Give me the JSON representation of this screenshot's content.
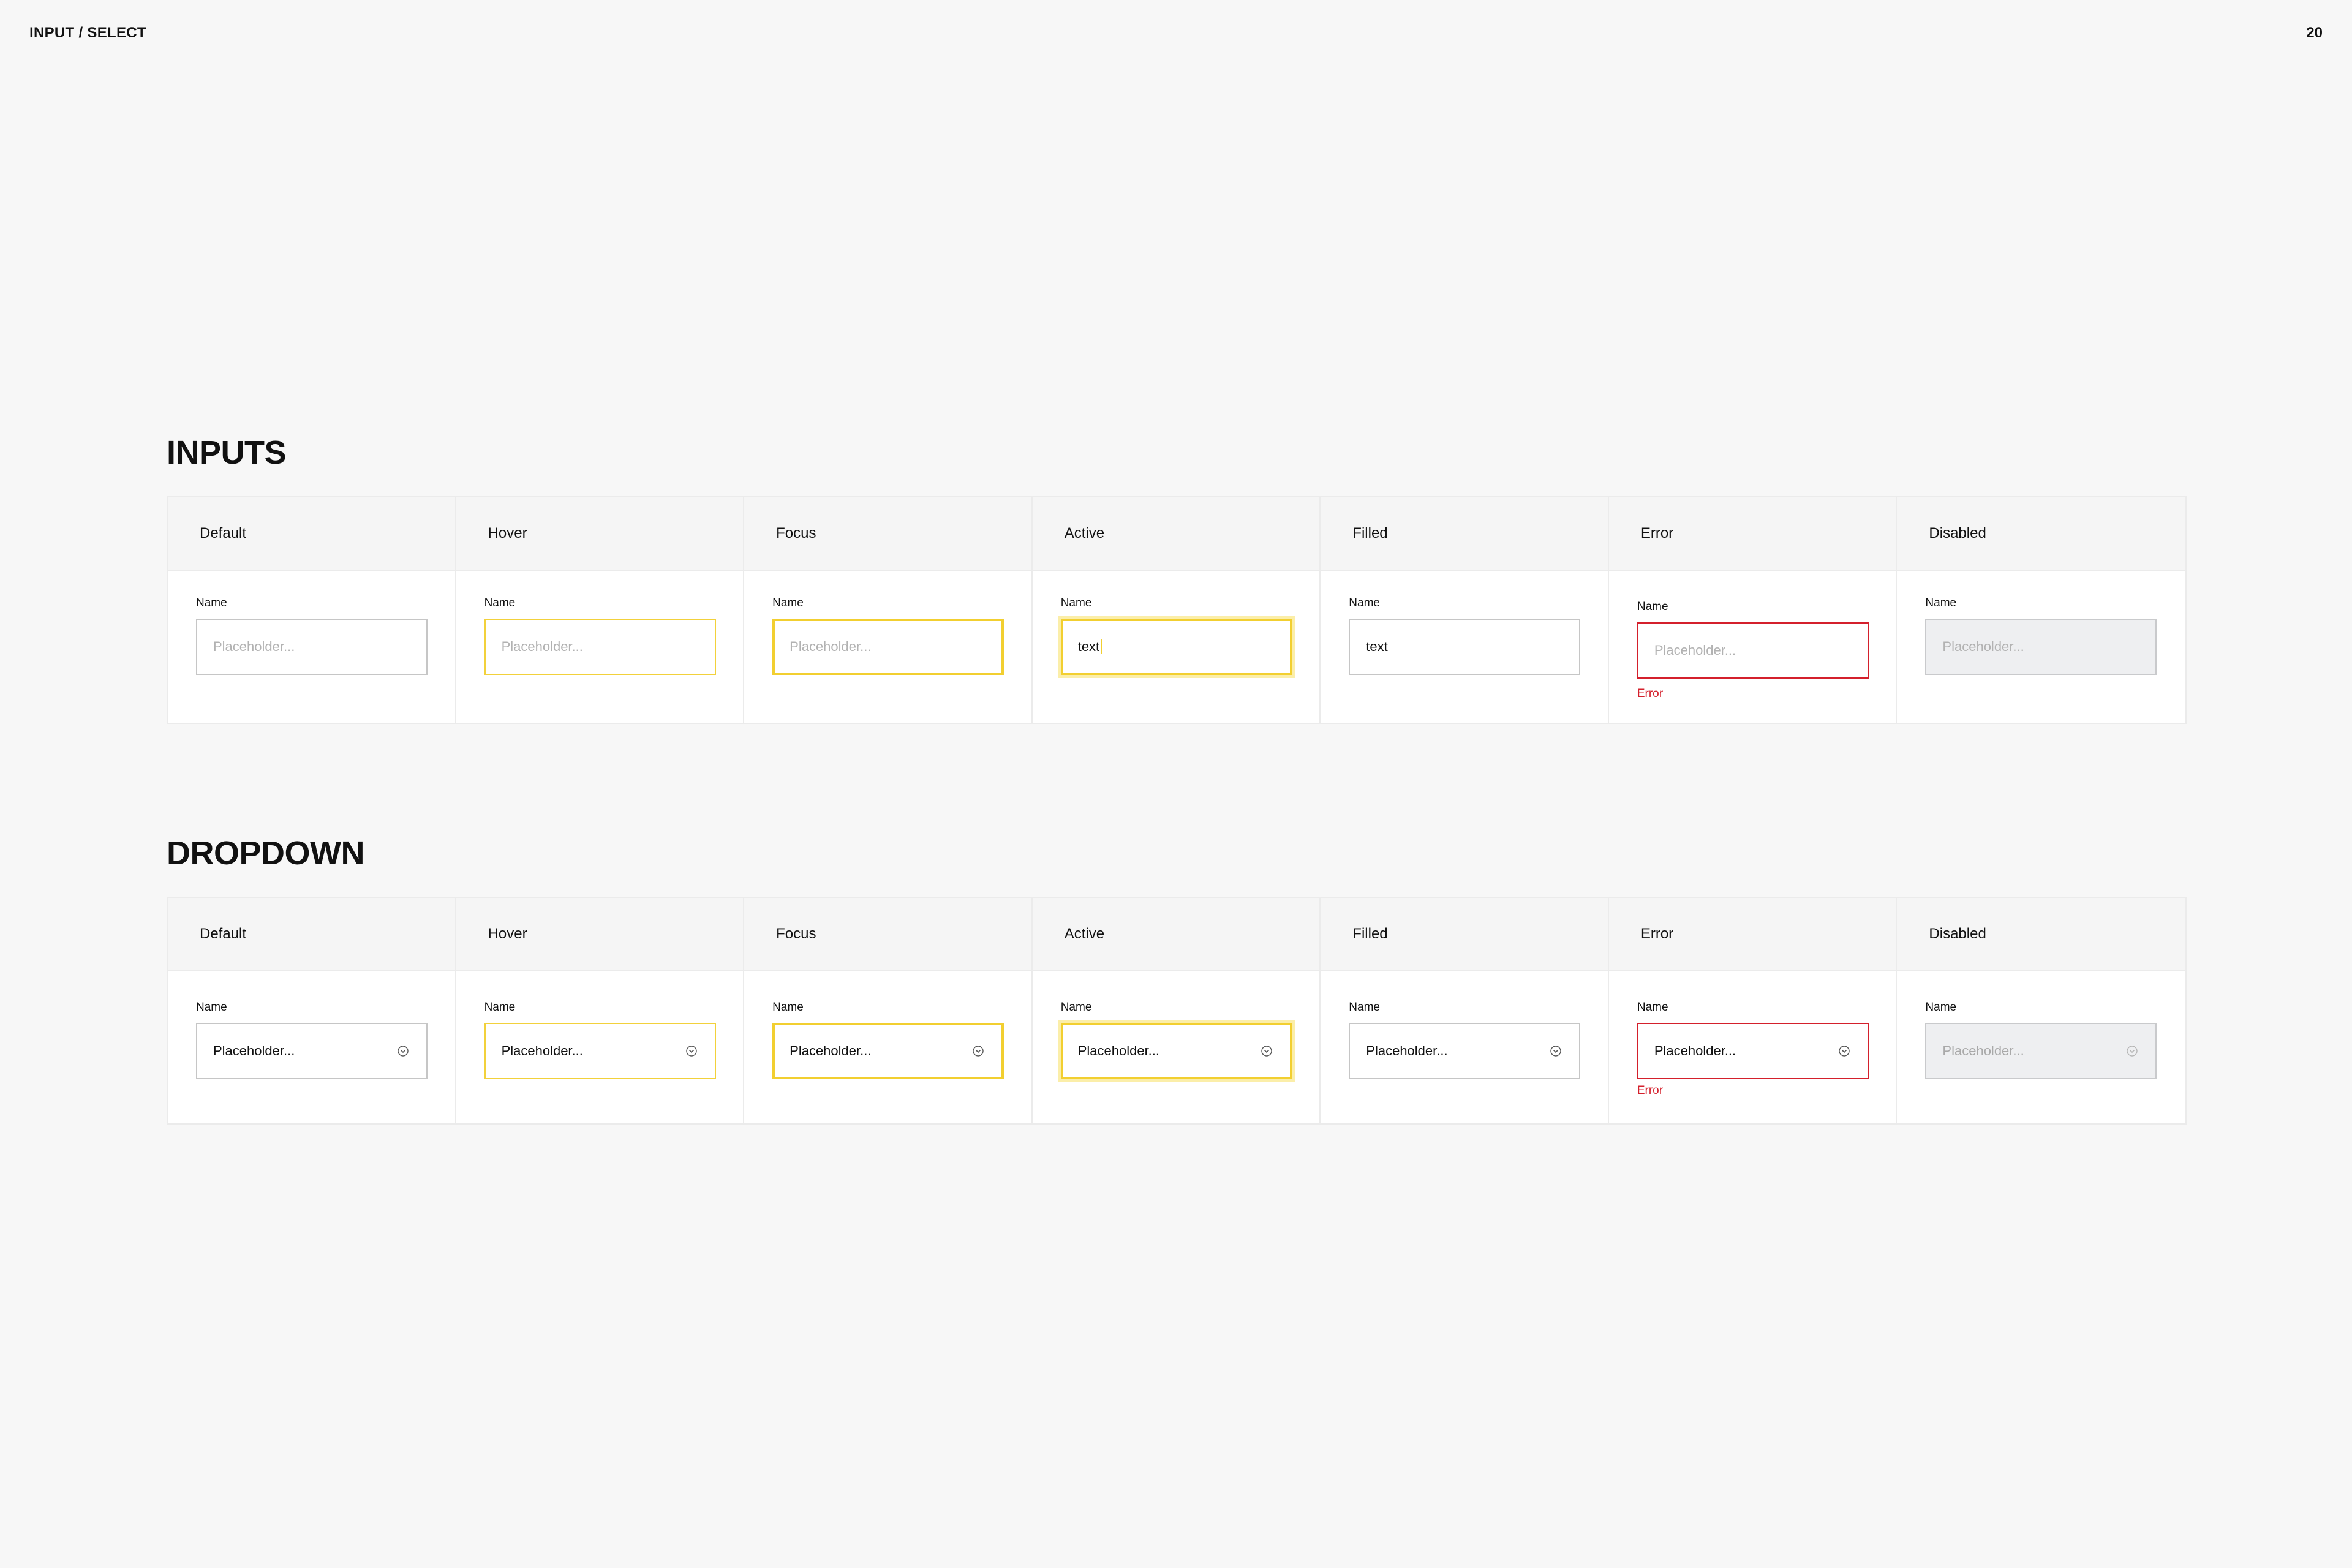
{
  "header": {
    "title": "INPUT / SELECT",
    "page_number": "20"
  },
  "inputs": {
    "title": "INPUTS",
    "columns": [
      "Default",
      "Hover",
      "Focus",
      "Active",
      "Filled",
      "Error",
      "Disabled"
    ],
    "field_label": "Name",
    "placeholder": "Placeholder...",
    "active_value": "text",
    "filled_value": "text",
    "error_message": "Error"
  },
  "dropdown": {
    "title": "DROPDOWN",
    "columns": [
      "Default",
      "Hover",
      "Focus",
      "Active",
      "Filled",
      "Error",
      "Disabled"
    ],
    "field_label": "Name",
    "value": "Placeholder...",
    "error_message": "Error",
    "icon": "chevron-down-icon"
  },
  "colors": {
    "background": "#f7f7f7",
    "accent_yellow": "#f2cf30",
    "error_red": "#d4202c",
    "disabled_fill": "#eeeff1",
    "border_default": "#c6c6c6"
  }
}
